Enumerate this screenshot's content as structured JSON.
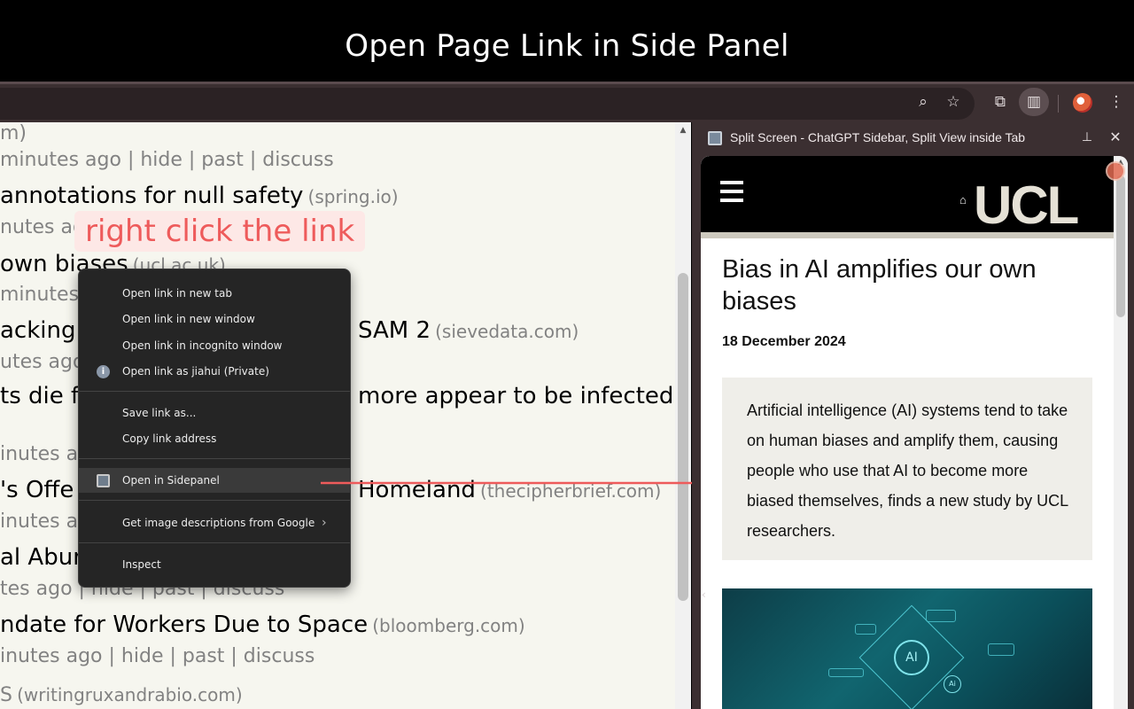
{
  "banner": {
    "title": "Open Page Link in Side Panel"
  },
  "toolbar": {
    "icons": [
      "zoom-icon",
      "star-icon",
      "extensions-icon",
      "side-panel-icon",
      "profile-avatar",
      "menu-icon"
    ]
  },
  "hn": {
    "lines": [
      {
        "title": "",
        "domain": "",
        "meta": "m)"
      },
      {
        "title": "",
        "domain": "",
        "meta": "minutes ago | hide | past | discuss"
      },
      {
        "title": "annotations for null safety",
        "domain": "(spring.io)",
        "meta": ""
      },
      {
        "title": "",
        "domain": "",
        "meta": "nutes ag"
      },
      {
        "title": "own biases",
        "domain": "(ucl.ac.uk)",
        "meta": ""
      },
      {
        "title": "",
        "domain": "",
        "meta": "minutes"
      },
      {
        "title": "acking",
        "domain": "",
        "meta": ""
      },
      {
        "title": "SAM 2",
        "domain": "(sievedata.com)",
        "meta": ""
      },
      {
        "title": "",
        "domain": "",
        "meta": "utes ago"
      },
      {
        "title": "ts die f",
        "domain": "",
        "meta": ""
      },
      {
        "title": "more appear to be infected",
        "domain": "",
        "meta": ""
      },
      {
        "title": "",
        "domain": "",
        "meta": "inutes ac"
      },
      {
        "title": "'s Offe",
        "domain": "",
        "meta": ""
      },
      {
        "title": "Homeland",
        "domain": "(thecipherbrief.com)",
        "meta": ""
      },
      {
        "title": "",
        "domain": "",
        "meta": "inutes ag"
      },
      {
        "title": "al Abur",
        "domain": "",
        "meta": ""
      },
      {
        "title": "",
        "domain": "",
        "meta": "tes ago | hide | past | discuss"
      },
      {
        "title": "ndate for Workers Due to Space",
        "domain": "(bloomberg.com)",
        "meta": ""
      },
      {
        "title": "",
        "domain": "",
        "meta": "inutes ago | hide | past | discuss"
      },
      {
        "title": "S",
        "domain": "(writingruxandrabio.com)",
        "meta": ""
      }
    ]
  },
  "annotation": {
    "text": "right click the link",
    "color": "#ee5b5b"
  },
  "context_menu": {
    "items": [
      {
        "label": "Open link in new tab"
      },
      {
        "label": "Open link in new window"
      },
      {
        "label": "Open link in incognito window"
      },
      {
        "label": "Open link as jiahui (Private)",
        "icon": "info-icon"
      },
      {
        "label": "Save link as..."
      },
      {
        "label": "Copy link address"
      },
      {
        "label": "Open in Sidepanel",
        "icon": "sidepanel-icon",
        "highlighted": true
      },
      {
        "label": "Get image descriptions from Google",
        "submenu": true
      },
      {
        "label": "Inspect"
      }
    ]
  },
  "side_panel": {
    "title": "Split Screen - ChatGPT Sidebar, Split View inside Tab",
    "logo_text": "UCL",
    "article": {
      "title": "Bias in AI amplifies our own biases",
      "date": "18 December 2024",
      "summary": "Artificial intelligence (AI) systems tend to take on human biases and amplify them, causing people who use that AI to become more biased themselves, finds a new study by UCL researchers.",
      "image_text": {
        "circle": "AI",
        "small": "Ai"
      }
    }
  },
  "colors": {
    "hn_background": "#f6f6ef",
    "browser_frame": "#3b2f31",
    "menu_background": "#252525",
    "arrow": "#ee5b5b"
  }
}
